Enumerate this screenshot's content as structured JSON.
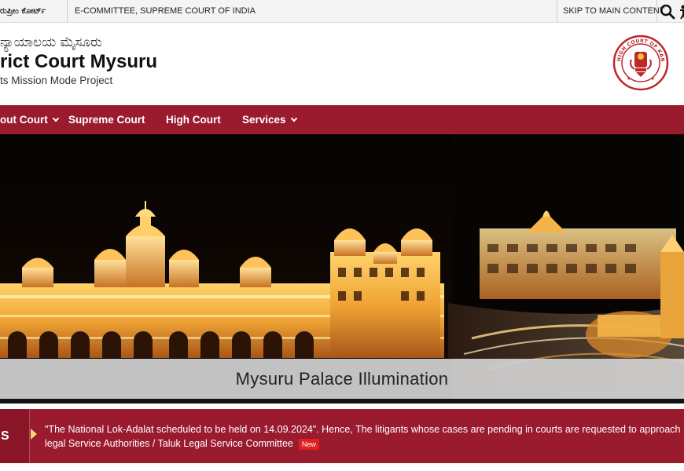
{
  "topbar": {
    "supreme_court_kn": "ರುಪ್ರೀಂ ಕೋರ್ಟ್",
    "ecommittee": "E-COMMITTEE, SUPREME COURT OF INDIA",
    "skip": "SKIP TO MAIN CONTENT"
  },
  "header": {
    "name_kn": "ನ್ಯಾಯಾಲಯ ಮೈಸೂರು",
    "court_name": "rict Court Mysuru",
    "tagline": "ts Mission Mode Project",
    "emblem_text": "HIGH COURT OF KARNATAKA"
  },
  "nav": {
    "items": [
      {
        "label": "out Court",
        "dropdown": true
      },
      {
        "label": "Supreme Court",
        "dropdown": false
      },
      {
        "label": "High Court",
        "dropdown": false
      },
      {
        "label": "Services",
        "dropdown": true
      }
    ]
  },
  "banner": {
    "caption": "Mysuru Palace Illumination"
  },
  "news": {
    "label": "S",
    "line1": "\"The National Lok-Adalat scheduled to be held on 14.09.2024\". Hence, The litigants whose cases are pending in courts are requested to approach Dis",
    "line2": "legal Service Authorities / Taluk Legal Service Committee",
    "badge": "New"
  },
  "colors": {
    "brand_maroon": "#9a1b2e",
    "topbar_bg": "#f4f4f4",
    "badge_red": "#e02020"
  }
}
